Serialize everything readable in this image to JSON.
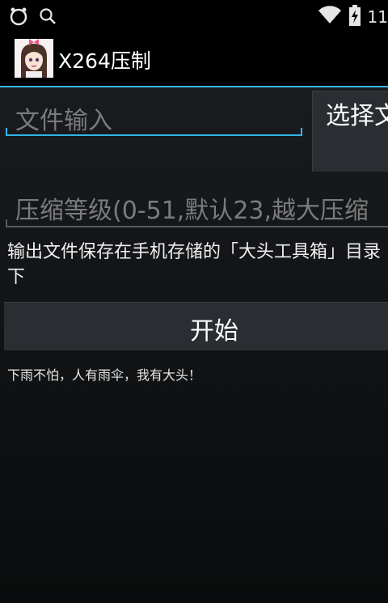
{
  "status_bar": {
    "left_icons": [
      "android-status-icon",
      "search-icon"
    ],
    "right_icons": [
      "wifi-icon",
      "battery-icon"
    ],
    "clock_partial": "11"
  },
  "action_bar": {
    "title": "X264压制",
    "app_icon": "avatar-app-icon"
  },
  "form": {
    "file_input_placeholder": "文件输入",
    "select_button_label": "选择文件",
    "level_input_placeholder": "压缩等级(0-51,默认23,越大压缩",
    "info_text": "输出文件保存在手机存储的「大头工具箱」目录下",
    "start_button_label": "开始",
    "footer_note": "下雨不怕，人有雨伞，我有大头！"
  },
  "colors": {
    "accent": "#33b5e5",
    "button_bg": "#2a2d31",
    "background": "#121416"
  }
}
